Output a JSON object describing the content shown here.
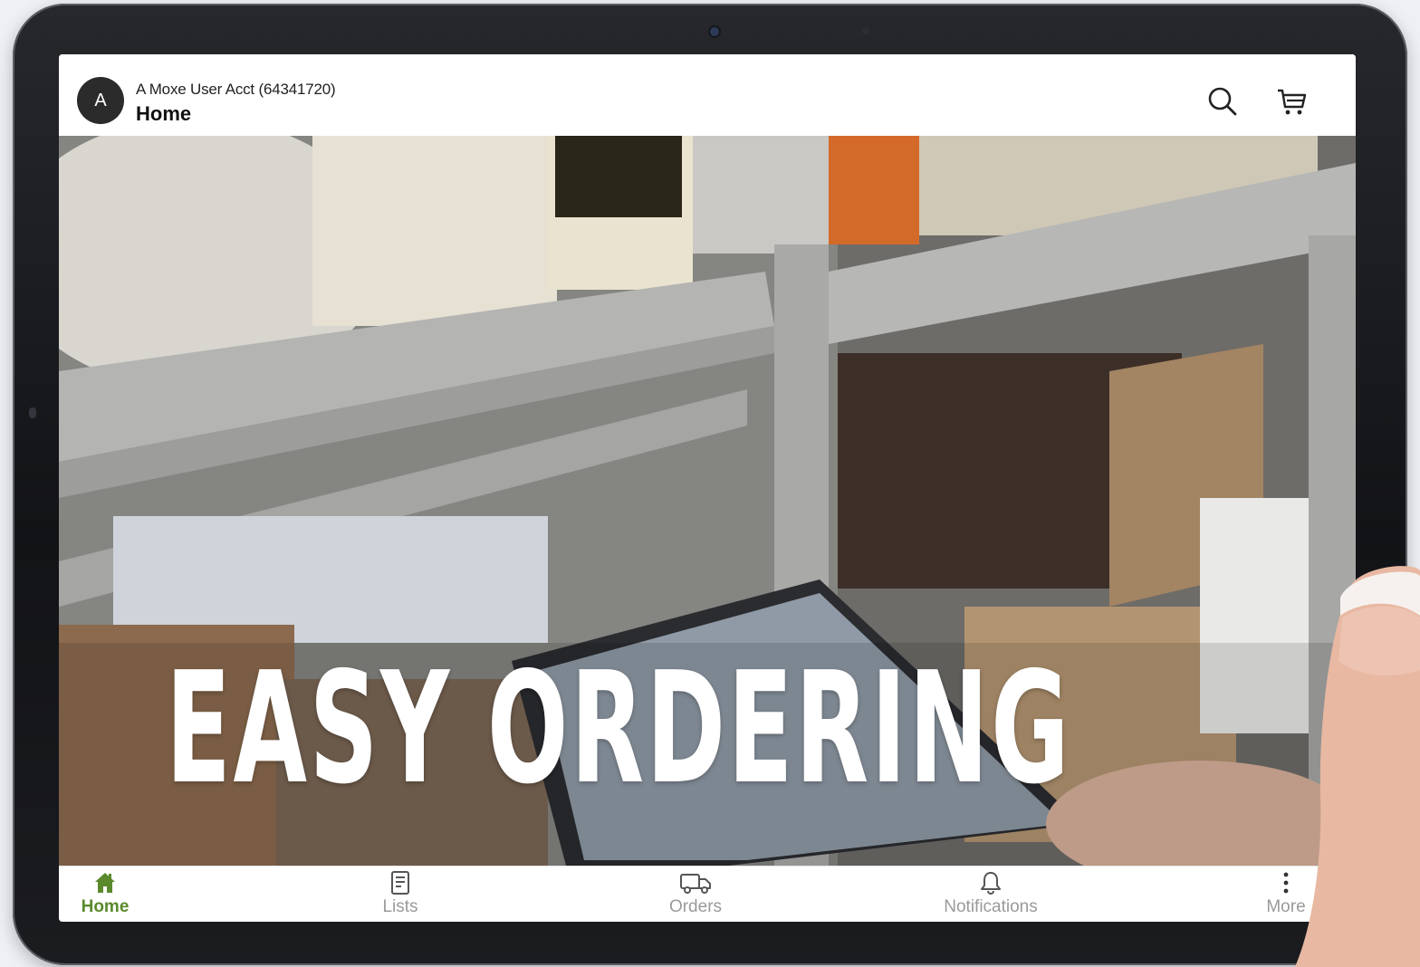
{
  "header": {
    "avatar_initial": "A",
    "account": "A Moxe User Acct (64341720)",
    "title": "Home"
  },
  "hero": {
    "headline": "EASY ORDERING"
  },
  "tabbar": {
    "items": [
      {
        "label": "Home",
        "icon": "home-icon",
        "active": true
      },
      {
        "label": "Lists",
        "icon": "list-icon",
        "active": false
      },
      {
        "label": "Orders",
        "icon": "truck-icon",
        "active": false
      },
      {
        "label": "Notifications",
        "icon": "bell-icon",
        "active": false
      },
      {
        "label": "More",
        "icon": "more-vertical-icon",
        "active": false
      }
    ]
  },
  "colors": {
    "accent": "#5a8a2c",
    "inactive": "#9a9a9a",
    "avatar_bg": "#2b2b2b"
  }
}
